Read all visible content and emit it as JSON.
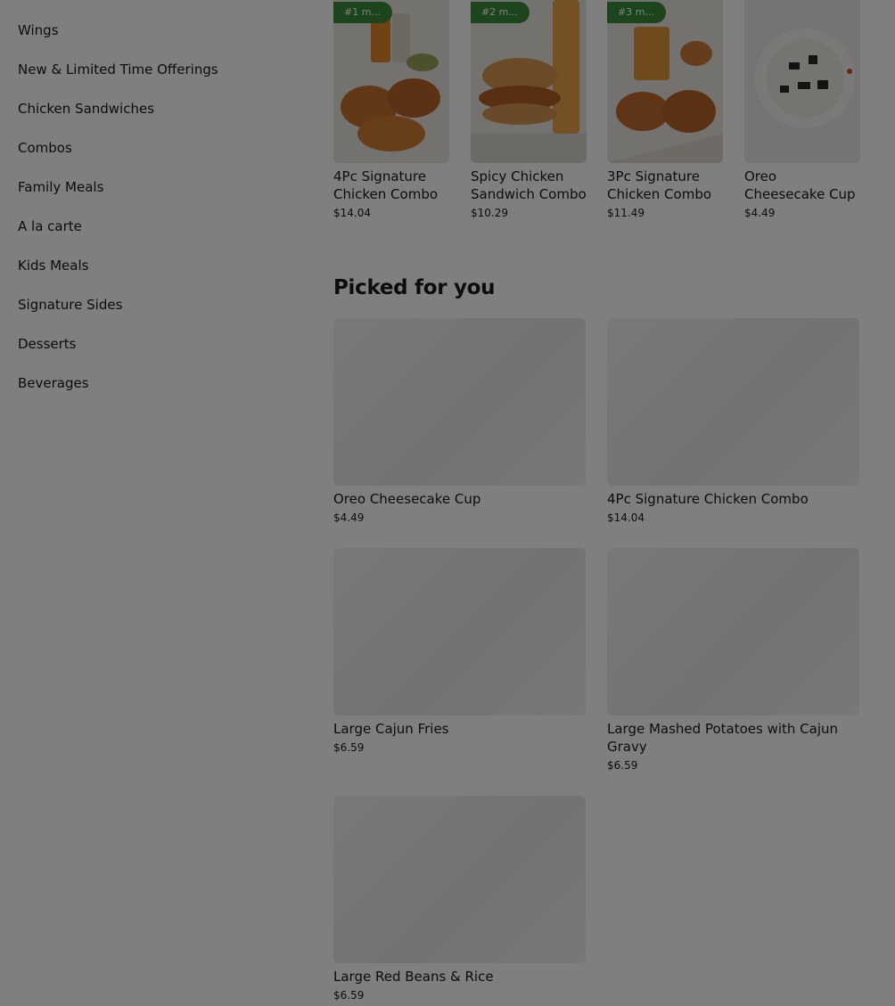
{
  "sidebar": {
    "categories": [
      "Wings",
      "New & Limited Time Offerings",
      "Chicken Sandwiches",
      "Combos",
      "Family Meals",
      "A la carte",
      "Kids Meals",
      "Signature Sides",
      "Desserts",
      "Beverages"
    ]
  },
  "popular": {
    "items": [
      {
        "badge": "#1 m...",
        "name": "4Pc Signature Chicken Combo",
        "price": "$14.04"
      },
      {
        "badge": "#2 m...",
        "name": "Spicy Chicken Sandwich Combo",
        "price": "$10.29"
      },
      {
        "badge": "#3 m...",
        "name": "3Pc Signature Chicken Combo",
        "price": "$11.49"
      },
      {
        "badge": "",
        "name": "Oreo Cheesecake Cup",
        "price": "$4.49"
      }
    ]
  },
  "picked": {
    "title": "Picked for you",
    "items": [
      {
        "name": "Oreo Cheesecake Cup",
        "price": "$4.49"
      },
      {
        "name": "4Pc Signature Chicken Combo",
        "price": "$14.04"
      },
      {
        "name": "Large Cajun Fries",
        "price": "$6.59"
      },
      {
        "name": "Large Mashed Potatoes with Cajun Gravy",
        "price": "$6.59"
      },
      {
        "name": "Large Red Beans & Rice",
        "price": "$6.59"
      }
    ]
  },
  "colors": {
    "badge_green": "#3a8a3a",
    "overlay": "rgba(0,0,0,0.5)"
  }
}
